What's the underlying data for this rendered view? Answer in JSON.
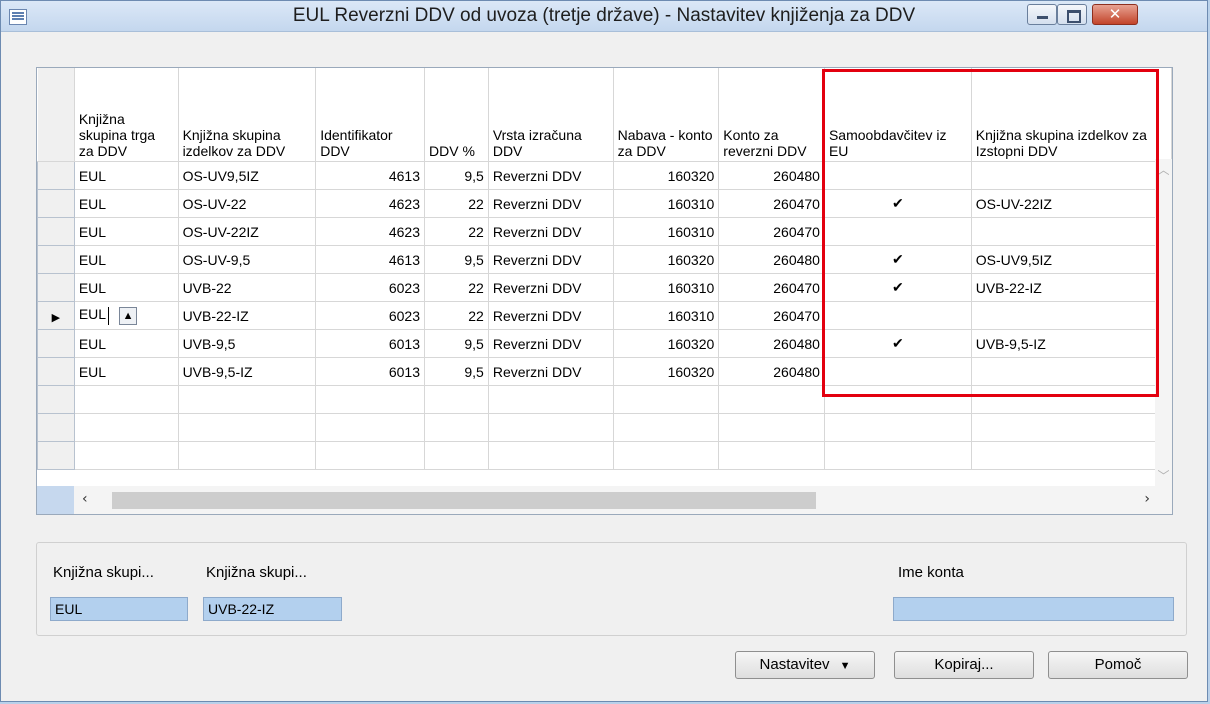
{
  "window": {
    "title": "EUL Reverzni DDV od uvoza (tretje države) - Nastavitev knjiženja za DDV"
  },
  "grid": {
    "columns": [
      "Knjižna skupina trga za DDV",
      "Knjižna skupina izdelkov za DDV",
      "Identifikator DDV",
      "DDV %",
      "Vrsta izračuna DDV",
      "Nabava - konto za DDV",
      "Konto za reverzni DDV",
      "Samoobdavčitev iz EU",
      "Knjižna skupina izdelkov za Izstopni DDV"
    ],
    "rows": [
      {
        "c0": "EUL",
        "c1": "OS-UV9,5IZ",
        "c2": "4613",
        "c3": "9,5",
        "c4": "Reverzni DDV",
        "c5": "160320",
        "c6": "260480",
        "c7": "",
        "c8": ""
      },
      {
        "c0": "EUL",
        "c1": "OS-UV-22",
        "c2": "4623",
        "c3": "22",
        "c4": "Reverzni DDV",
        "c5": "160310",
        "c6": "260470",
        "c7": "✔",
        "c8": "OS-UV-22IZ"
      },
      {
        "c0": "EUL",
        "c1": "OS-UV-22IZ",
        "c2": "4623",
        "c3": "22",
        "c4": "Reverzni DDV",
        "c5": "160310",
        "c6": "260470",
        "c7": "",
        "c8": ""
      },
      {
        "c0": "EUL",
        "c1": "OS-UV-9,5",
        "c2": "4613",
        "c3": "9,5",
        "c4": "Reverzni DDV",
        "c5": "160320",
        "c6": "260480",
        "c7": "✔",
        "c8": "OS-UV9,5IZ"
      },
      {
        "c0": "EUL",
        "c1": "UVB-22",
        "c2": "6023",
        "c3": "22",
        "c4": "Reverzni DDV",
        "c5": "160310",
        "c6": "260470",
        "c7": "✔",
        "c8": "UVB-22-IZ"
      },
      {
        "c0": "EUL",
        "c1": "UVB-22-IZ",
        "c2": "6023",
        "c3": "22",
        "c4": "Reverzni DDV",
        "c5": "160310",
        "c6": "260470",
        "c7": "",
        "c8": ""
      },
      {
        "c0": "EUL",
        "c1": "UVB-9,5",
        "c2": "6013",
        "c3": "9,5",
        "c4": "Reverzni DDV",
        "c5": "160320",
        "c6": "260480",
        "c7": "✔",
        "c8": "UVB-9,5-IZ"
      },
      {
        "c0": "EUL",
        "c1": "UVB-9,5-IZ",
        "c2": "6013",
        "c3": "9,5",
        "c4": "Reverzni DDV",
        "c5": "160320",
        "c6": "260480",
        "c7": "",
        "c8": ""
      }
    ],
    "current_row_marker": "▶",
    "lookup_icon": "up-arrow-icon"
  },
  "details": {
    "label1": "Knjižna skupi...",
    "value1": "EUL",
    "label2": "Knjižna skupi...",
    "value2": "UVB-22-IZ",
    "label3": "Ime konta",
    "value3": ""
  },
  "buttons": {
    "nastavitev": "Nastavitev",
    "kopiraj": "Kopiraj...",
    "pomoc": "Pomoč"
  },
  "colors": {
    "highlight_box": "#e3000f",
    "field_bg": "#b3d0ee"
  }
}
